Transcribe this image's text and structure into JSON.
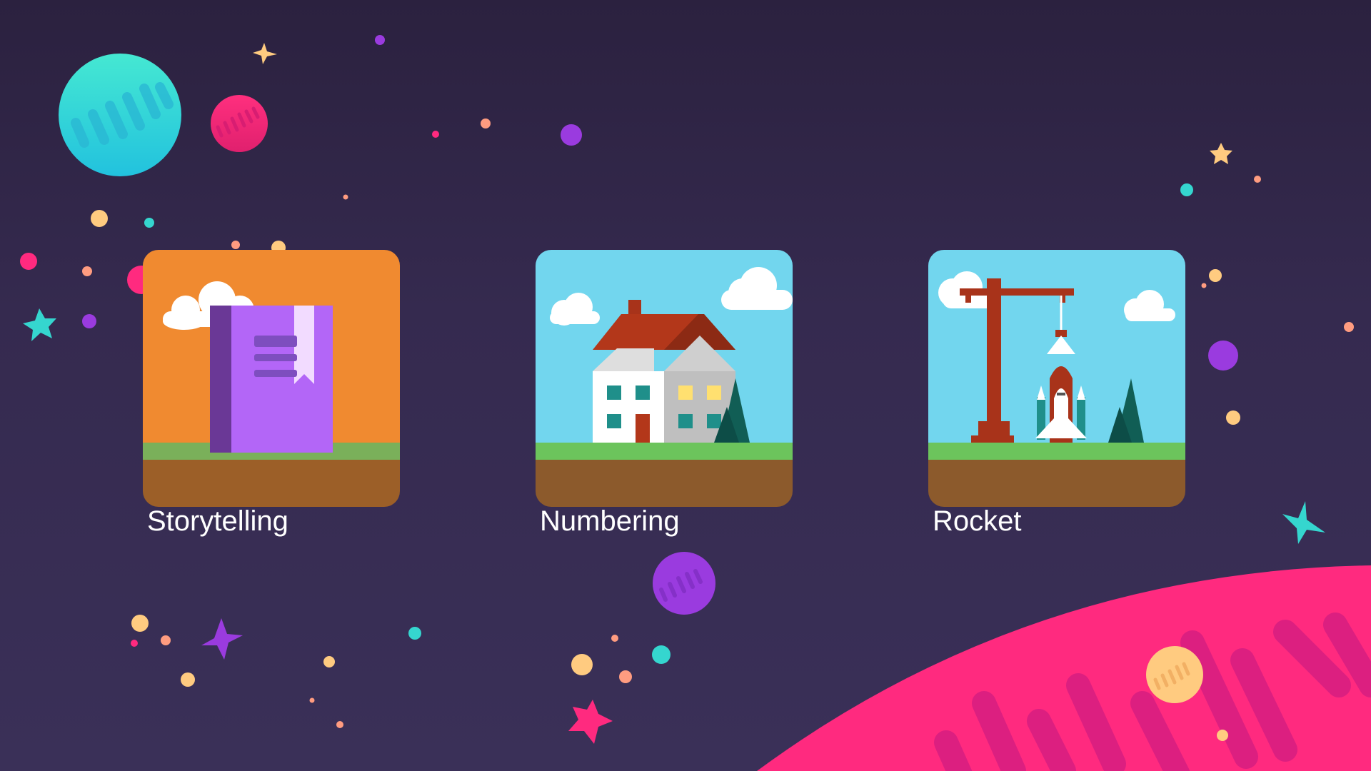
{
  "activities": [
    {
      "label": "Storytelling",
      "icon": "book-icon"
    },
    {
      "label": "Numbering",
      "icon": "house-icon"
    },
    {
      "label": "Rocket",
      "icon": "rocket-launch-icon"
    }
  ],
  "colors": {
    "background": "#2e2443",
    "planet_teal": "#35d6cf",
    "planet_pink": "#ff2a7f",
    "planet_purple": "#9a3bdf",
    "planet_yellow": "#ffcb80",
    "sky": "#72d6ee",
    "orange_sky": "#f08a30",
    "grass": "#6cc45c",
    "soil": "#8c5a2c"
  }
}
